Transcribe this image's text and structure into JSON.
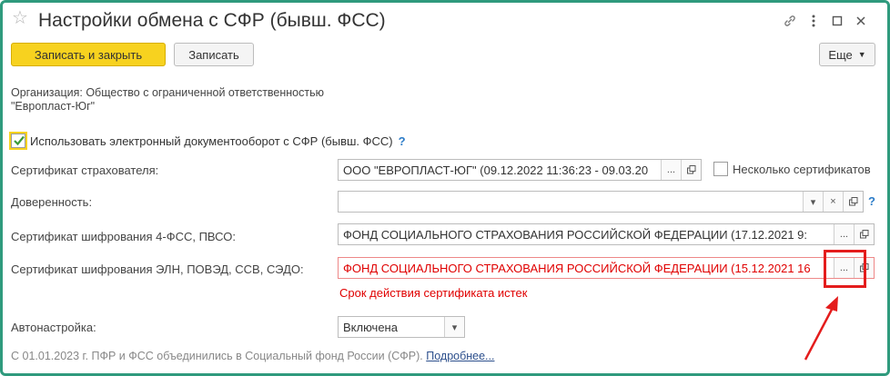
{
  "window": {
    "title": "Настройки обмена с СФР (бывш. ФСС)",
    "icons": [
      "star-icon",
      "link-icon",
      "more-vert-icon",
      "maximize-icon",
      "close-icon"
    ]
  },
  "toolbar": {
    "save_close_label": "Записать и закрыть",
    "save_label": "Записать",
    "more_label": "Еще"
  },
  "organization": {
    "line1": "Организация: Общество с ограниченной ответственностью",
    "line2": "\"Европласт-Юг\""
  },
  "edo": {
    "checkbox_label": "Использовать электронный документооборот с СФР (бывш. ФСС)",
    "checked": true,
    "help": "?"
  },
  "fields": {
    "insurer_cert": {
      "label": "Сертификат страхователя:",
      "value": "ООО \"ЕВРОПЛАСТ-ЮГ\" (09.12.2022 11:36:23 - 09.03.20"
    },
    "multiple_certs": {
      "label": "Несколько сертификатов",
      "checked": false
    },
    "power_of_attorney": {
      "label": "Доверенность:",
      "value": ""
    },
    "enc_cert_4fss": {
      "label": "Сертификат шифрования 4-ФСС, ПВСО:",
      "value": "ФОНД СОЦИАЛЬНОГО СТРАХОВАНИЯ РОССИЙСКОЙ ФЕДЕРАЦИИ (17.12.2021 9:"
    },
    "enc_cert_eln": {
      "label": "Сертификат шифрования ЭЛН, ПОВЭД, ССВ, СЭДО:",
      "value": "ФОНД СОЦИАЛЬНОГО СТРАХОВАНИЯ РОССИЙСКОЙ ФЕДЕРАЦИИ (15.12.2021 16",
      "error": "Срок действия сертификата истек"
    },
    "auto_setup": {
      "label": "Автонастройка:",
      "value": "Включена"
    }
  },
  "footer": {
    "text": "С 01.01.2023 г. ПФР и ФСС объединились в Социальный фонд России (СФР).",
    "link": "Подробнее..."
  },
  "glyphs": {
    "ellipsis": "...",
    "help": "?",
    "clear": "×",
    "dropdown": "▾"
  },
  "colors": {
    "accent_yellow": "#f7d21f",
    "error_red": "#e00000",
    "frame_green": "#2f9a7d",
    "annotation_red": "#e41c1c",
    "link_blue": "#2c4f8c"
  }
}
